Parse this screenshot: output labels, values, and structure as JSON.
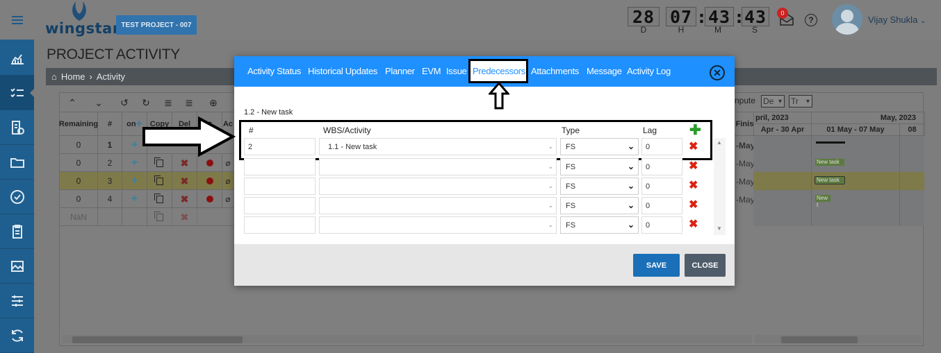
{
  "app": {
    "logo_text": "wingstar",
    "project": "TEST PROJECT - 007"
  },
  "countdown": {
    "days": "28",
    "hours": "07",
    "minutes": "43",
    "seconds": "43",
    "labels": [
      "D",
      "H",
      "M",
      "S"
    ]
  },
  "notifications": {
    "count": "0"
  },
  "user": {
    "name": "Vijay Shukla"
  },
  "page": {
    "title": "PROJECT ACTIVITY",
    "breadcrumb": [
      "Home",
      "Activity"
    ]
  },
  "grid": {
    "headers": [
      "Remaining",
      "#",
      "on",
      "Copy",
      "Del",
      "",
      "Ac"
    ],
    "rows": [
      {
        "remaining": "0",
        "num": "1",
        "finish": "-May"
      },
      {
        "remaining": "0",
        "num": "2",
        "finish": "-May"
      },
      {
        "remaining": "0",
        "num": "3",
        "finish": "-May"
      },
      {
        "remaining": "0",
        "num": "4",
        "finish": "-May"
      },
      {
        "remaining": "NaN",
        "num": "",
        "finish": ""
      }
    ],
    "compute_label": "npute",
    "select1": "De",
    "select2": "Tr",
    "finish_header": "Finis",
    "gantt": {
      "month1": "pril, 2023",
      "month2": "May, 2023",
      "week0": "Apr - 30 Apr",
      "week1": "01 May - 07 May",
      "week2": "08",
      "tasks": [
        "New task",
        "New task",
        "New t"
      ]
    }
  },
  "modal": {
    "tabs": [
      "Activity Status",
      "Historical Updates",
      "Planner",
      "EVM",
      "Issue",
      "Predecessors",
      "Attachments",
      "Message",
      "Activity Log"
    ],
    "active_tab": "Predecessors",
    "subtitle": "1.2 - New task",
    "columns": {
      "num": "#",
      "wbs": "WBS/Activity",
      "type": "Type",
      "lag": "Lag"
    },
    "rows": [
      {
        "num": "2",
        "wbs": "1.1 - New task",
        "type": "FS",
        "lag": "0"
      },
      {
        "num": "",
        "wbs": "",
        "type": "FS",
        "lag": "0"
      },
      {
        "num": "",
        "wbs": "",
        "type": "FS",
        "lag": "0"
      },
      {
        "num": "",
        "wbs": "",
        "type": "FS",
        "lag": "0"
      },
      {
        "num": "",
        "wbs": "",
        "type": "FS",
        "lag": "0"
      }
    ],
    "save_label": "SAVE",
    "close_label": "CLOSE"
  },
  "colors": {
    "modal_header": "#1e90ff",
    "save": "#1a6fb8",
    "close": "#4f5d6a",
    "sidebar": "#1f5f8f",
    "delete": "#d21111",
    "add": "#2a9d2a"
  }
}
